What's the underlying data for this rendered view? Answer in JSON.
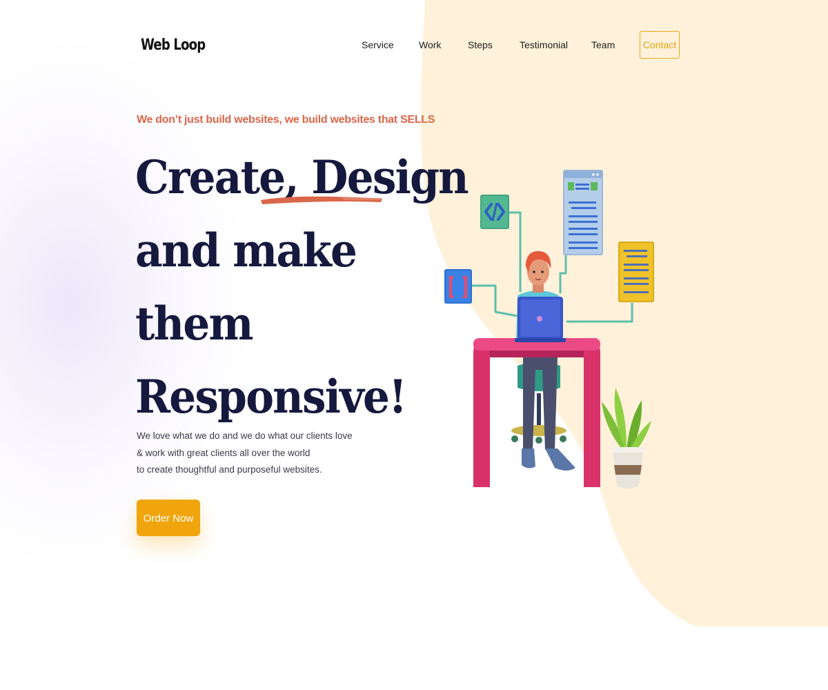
{
  "brand": {
    "logo_text": "Web Loop"
  },
  "nav": {
    "items": [
      {
        "label": "Service"
      },
      {
        "label": "Work"
      },
      {
        "label": "Steps"
      },
      {
        "label": "Testimonial"
      },
      {
        "label": "Team"
      }
    ],
    "contact_label": "Contact"
  },
  "hero": {
    "tagline": "We don’t just build websites, we build websites that SELLS",
    "headline_lines": [
      "Create, Design",
      "and make",
      "them",
      "Responsive!"
    ],
    "description_lines": [
      "We love what we do and we do what our clients love",
      "& work with great clients all over the world",
      "to create thoughtful and purposeful websites."
    ],
    "cta_label": "Order Now"
  },
  "colors": {
    "accent": "#f0a50c",
    "tagline": "#d9674a",
    "headline": "#16193e",
    "blob": "#fff1da"
  },
  "illustration": {
    "icons": [
      "code-icon",
      "bracket-icon",
      "webpage-window-icon",
      "document-icon",
      "laptop-icon",
      "plant-icon"
    ]
  }
}
